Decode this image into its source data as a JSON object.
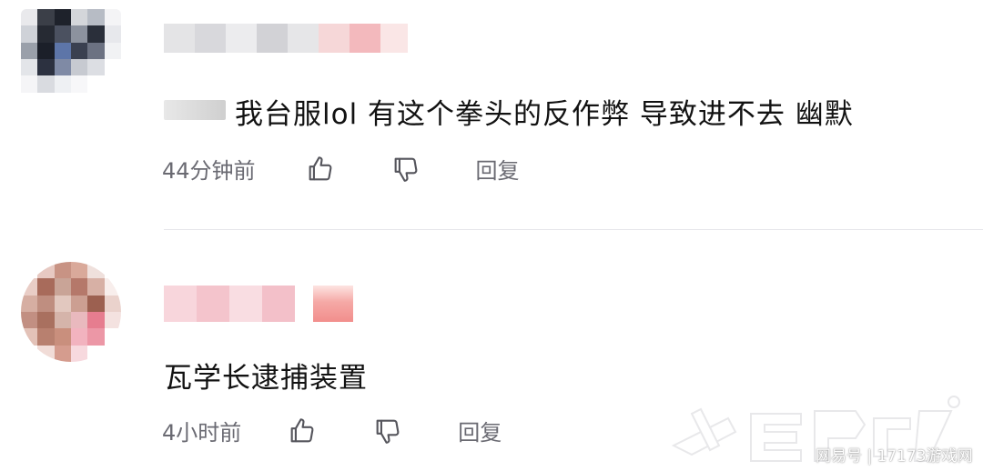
{
  "comments": [
    {
      "text": "我台服lol 有这个拳头的反作弊  导致进不去 幽默",
      "time": "44分钟前",
      "reply_label": "回复"
    },
    {
      "text": "瓦学长逮捕装置",
      "time": "4小时前",
      "reply_label": "回复"
    }
  ],
  "icons": {
    "like": "thumbs-up-icon",
    "dislike": "thumbs-down-icon"
  },
  "watermark": {
    "text": "网易号 | 17173游戏网"
  }
}
